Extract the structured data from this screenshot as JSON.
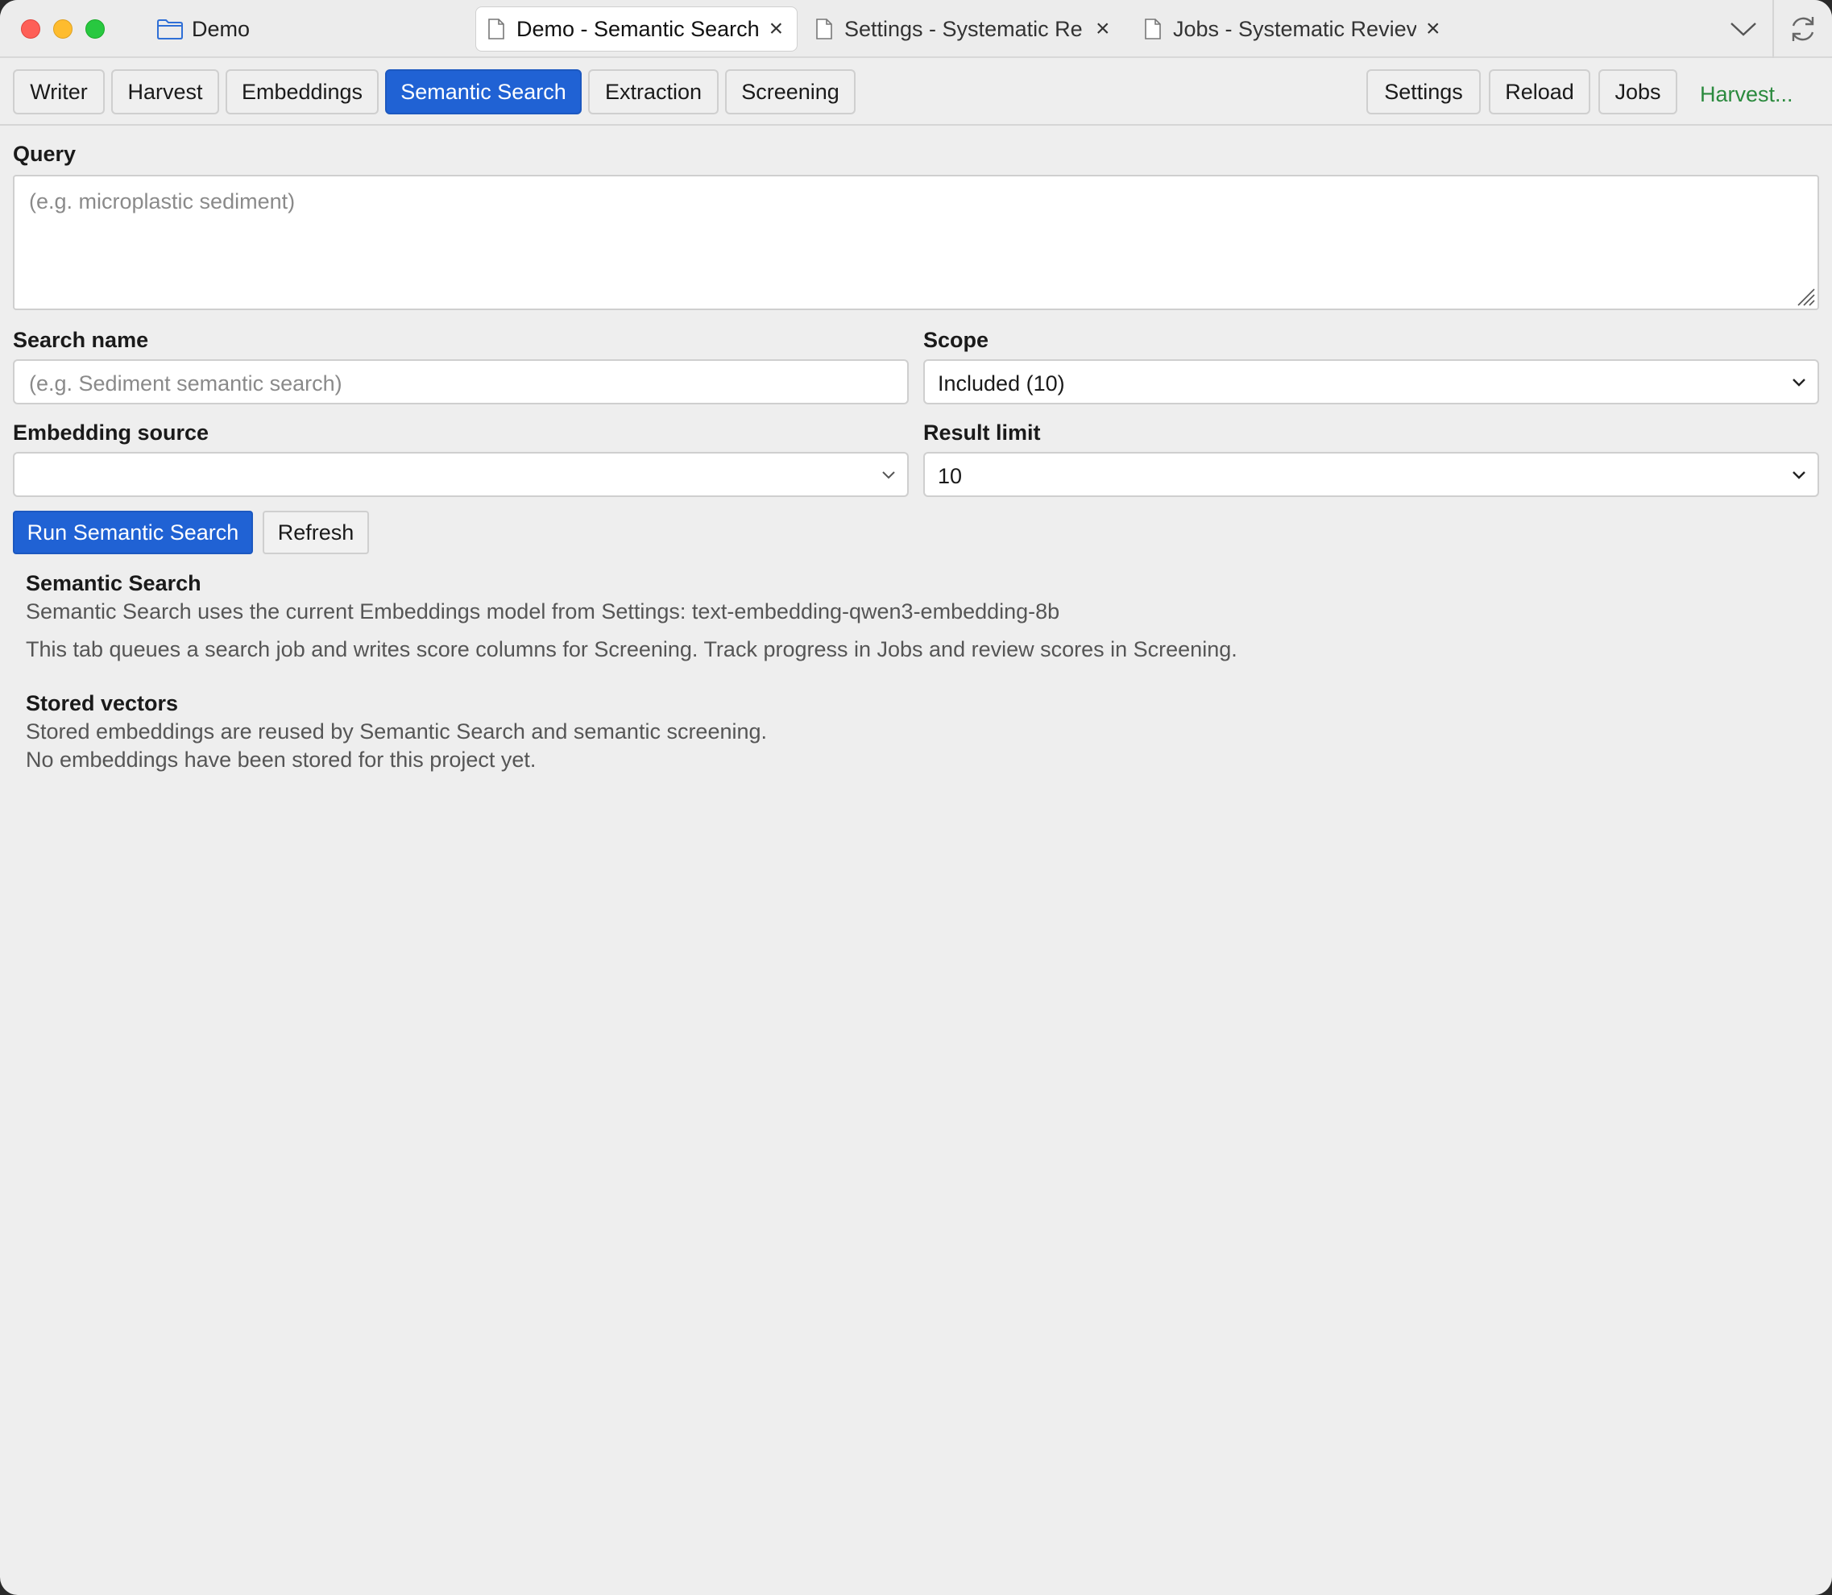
{
  "titlebar": {
    "folder_label": "Demo",
    "tabs": [
      {
        "label": "Demo - Semantic Search",
        "active": true
      },
      {
        "label": "Settings - Systematic Re",
        "active": false
      },
      {
        "label": "Jobs - Systematic Reviev",
        "active": false
      }
    ]
  },
  "toolbar": {
    "nav": [
      "Writer",
      "Harvest",
      "Embeddings",
      "Semantic Search",
      "Extraction",
      "Screening"
    ],
    "active_nav": "Semantic Search",
    "right": [
      "Settings",
      "Reload",
      "Jobs"
    ],
    "harvest_link": "Harvest..."
  },
  "form": {
    "query_label": "Query",
    "query_placeholder": "(e.g. microplastic sediment)",
    "search_name_label": "Search name",
    "search_name_placeholder": "(e.g. Sediment semantic search)",
    "scope_label": "Scope",
    "scope_value": "Included (10)",
    "embedding_source_label": "Embedding source",
    "embedding_source_value": "",
    "result_limit_label": "Result limit",
    "result_limit_value": "10"
  },
  "actions": {
    "run_label": "Run Semantic Search",
    "refresh_label": "Refresh"
  },
  "info": {
    "semantic_title": "Semantic Search",
    "semantic_line1": "Semantic Search uses the current Embeddings model from Settings: text-embedding-qwen3-embedding-8b",
    "semantic_line2": "This tab queues a search job and writes score columns for Screening. Track progress in Jobs and review scores in Screening.",
    "vectors_title": "Stored vectors",
    "vectors_line1": "Stored embeddings are reused by Semantic Search and semantic screening.",
    "vectors_line2": "No embeddings have been stored for this project yet."
  },
  "colors": {
    "accent": "#2062d4",
    "harvest_link": "#2b8a3e",
    "close": "#fe5f57",
    "minimize": "#febc2e",
    "zoom": "#28c840"
  },
  "icons": [
    "folder-icon",
    "document-icon",
    "close-icon",
    "chevron-down-icon",
    "refresh-icon",
    "resize-grip-icon"
  ]
}
